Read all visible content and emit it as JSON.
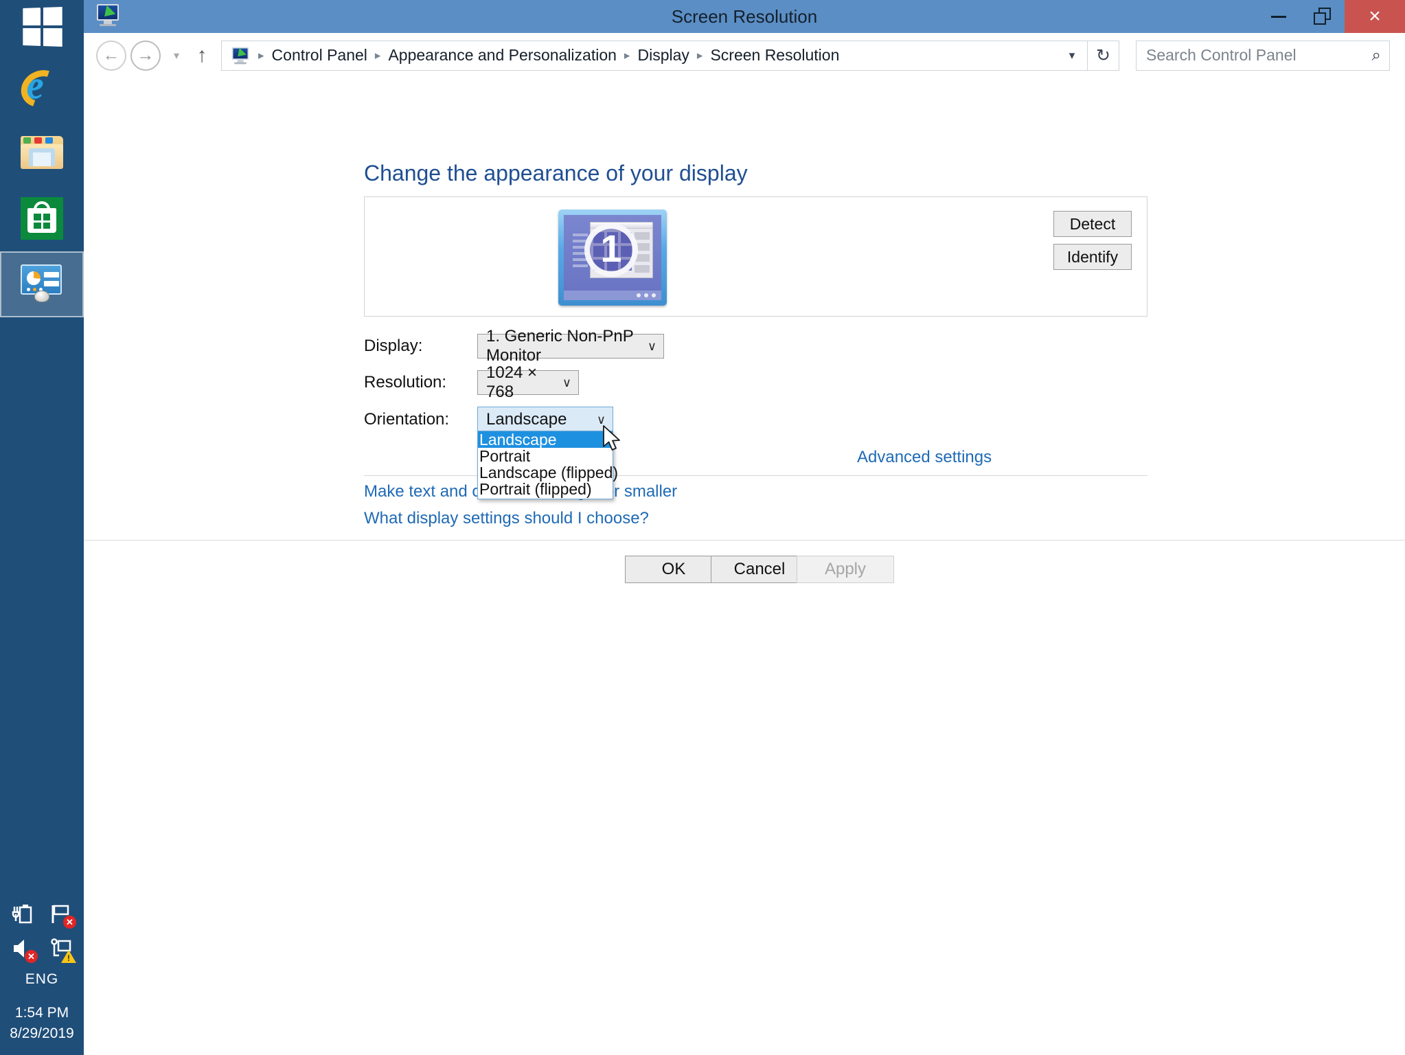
{
  "taskbar": {
    "start": {
      "name": "Start",
      "icon": "windows-logo-icon"
    },
    "items": [
      {
        "label": "Internet Explorer",
        "icon": "internet-explorer-icon",
        "active": false
      },
      {
        "label": "File Explorer",
        "icon": "file-explorer-icon",
        "active": false
      },
      {
        "label": "Store",
        "icon": "store-icon",
        "active": false
      },
      {
        "label": "Control Panel",
        "icon": "control-panel-icon",
        "active": true
      }
    ],
    "tray": {
      "icons": [
        {
          "name": "power-battery-icon",
          "badge": ""
        },
        {
          "name": "action-center-flag-icon",
          "badge": "x"
        },
        {
          "name": "volume-muted-icon",
          "badge": "x"
        },
        {
          "name": "network-warning-icon",
          "badge": "!"
        }
      ],
      "language": "ENG",
      "time": "1:54 PM",
      "date": "8/29/2019"
    }
  },
  "window": {
    "title": "Screen Resolution",
    "icon": "screen-resolution-icon",
    "controls": {
      "minimize": "Minimize",
      "restore": "Restore",
      "close": "×"
    }
  },
  "navigation": {
    "back": "←",
    "forward": "→",
    "recent_dropdown": "▾",
    "up": "↑",
    "breadcrumb_icon": "screen-resolution-icon",
    "breadcrumbs": [
      "Control Panel",
      "Appearance and Personalization",
      "Display",
      "Screen Resolution"
    ],
    "separator": "▸",
    "address_dropdown": "▾",
    "refresh": "↻"
  },
  "search": {
    "placeholder": "Search Control Panel",
    "value": "",
    "icon": "search-icon"
  },
  "main": {
    "heading": "Change the appearance of your display",
    "preview": {
      "monitor_number": "1"
    },
    "detect_label": "Detect",
    "identify_label": "Identify",
    "fields": {
      "display": {
        "label": "Display:",
        "value": "1. Generic Non-PnP Monitor",
        "caret": "∨"
      },
      "resolution": {
        "label": "Resolution:",
        "value": "1024 × 768",
        "caret": "∨"
      },
      "orientation": {
        "label": "Orientation:",
        "value": "Landscape",
        "caret": "∨",
        "open": true,
        "options": [
          {
            "label": "Landscape",
            "selected": true
          },
          {
            "label": "Portrait",
            "selected": false
          },
          {
            "label": "Landscape (flipped)",
            "selected": false
          },
          {
            "label": "Portrait (flipped)",
            "selected": false
          }
        ]
      }
    },
    "links": {
      "advanced_settings": "Advanced settings",
      "make_text_larger": "Make text and other items larger or smaller",
      "what_display_settings": "What display settings should I choose?"
    }
  },
  "footer": {
    "ok": "OK",
    "cancel": "Cancel",
    "apply": "Apply"
  },
  "colors": {
    "titlebar": "#5b8ec4",
    "close_button": "#c9544f",
    "taskbar": "#1f4e79",
    "link": "#1f6ab5",
    "heading": "#1f4f91",
    "selection": "#1e90e0"
  }
}
